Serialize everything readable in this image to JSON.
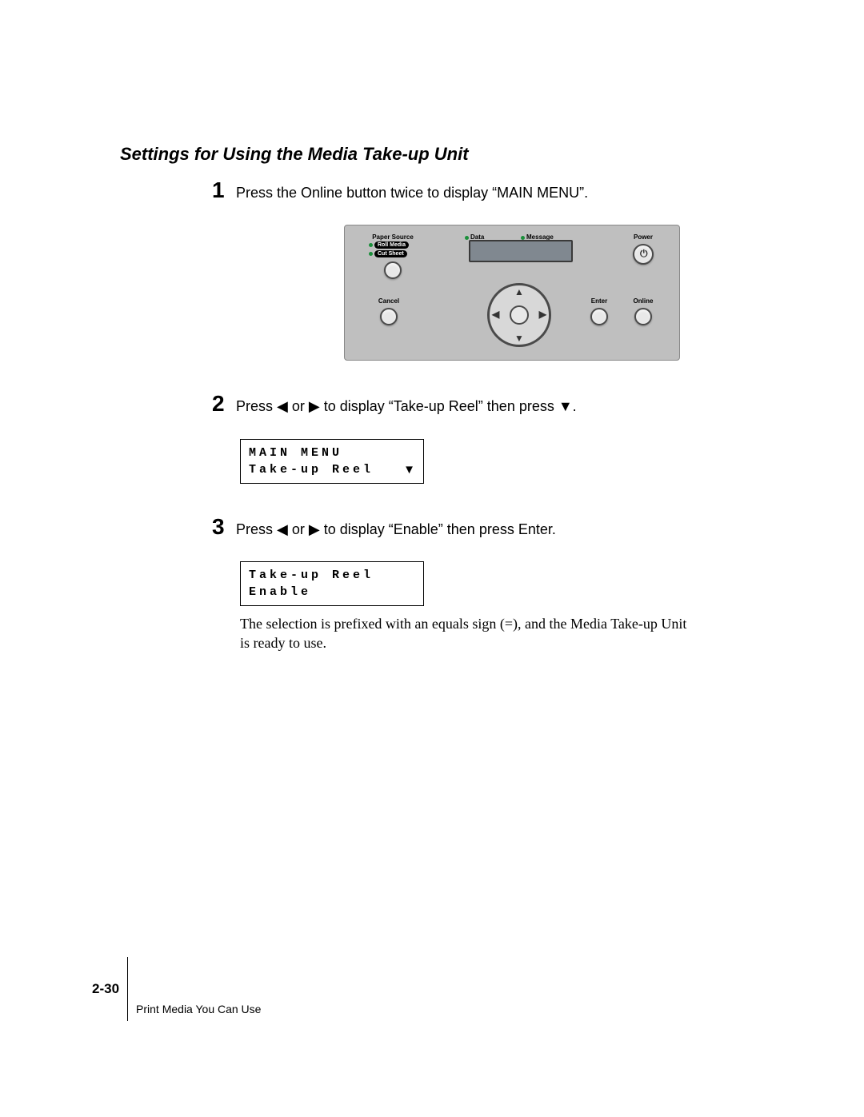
{
  "section_title": "Settings for Using the Media Take-up Unit",
  "steps": {
    "s1": {
      "num": "1",
      "text": "Press the Online button twice to display “MAIN MENU”."
    },
    "s2": {
      "num": "2",
      "text": "Press ◀ or ▶ to display “Take-up Reel” then press ▼."
    },
    "s3": {
      "num": "3",
      "text": "Press ◀ or ▶ to display “Enable” then press Enter."
    }
  },
  "panel": {
    "paper_source": "Paper Source",
    "roll_media": "Roll Media",
    "cut_sheet": "Cut Sheet",
    "data": "Data",
    "message": "Message",
    "power": "Power",
    "cancel": "Cancel",
    "enter": "Enter",
    "online": "Online"
  },
  "lcd1": {
    "line1": "MAIN MENU",
    "line2": "Take-up Reel",
    "indicator": "▼"
  },
  "lcd2": {
    "line1": "Take-up Reel",
    "line2": "Enable"
  },
  "closing_para": "The selection is prefixed with an equals sign (=), and the Media Take-up Unit is ready to use.",
  "footer": {
    "page_number": "2-30",
    "chapter": "Print Media You Can Use"
  }
}
